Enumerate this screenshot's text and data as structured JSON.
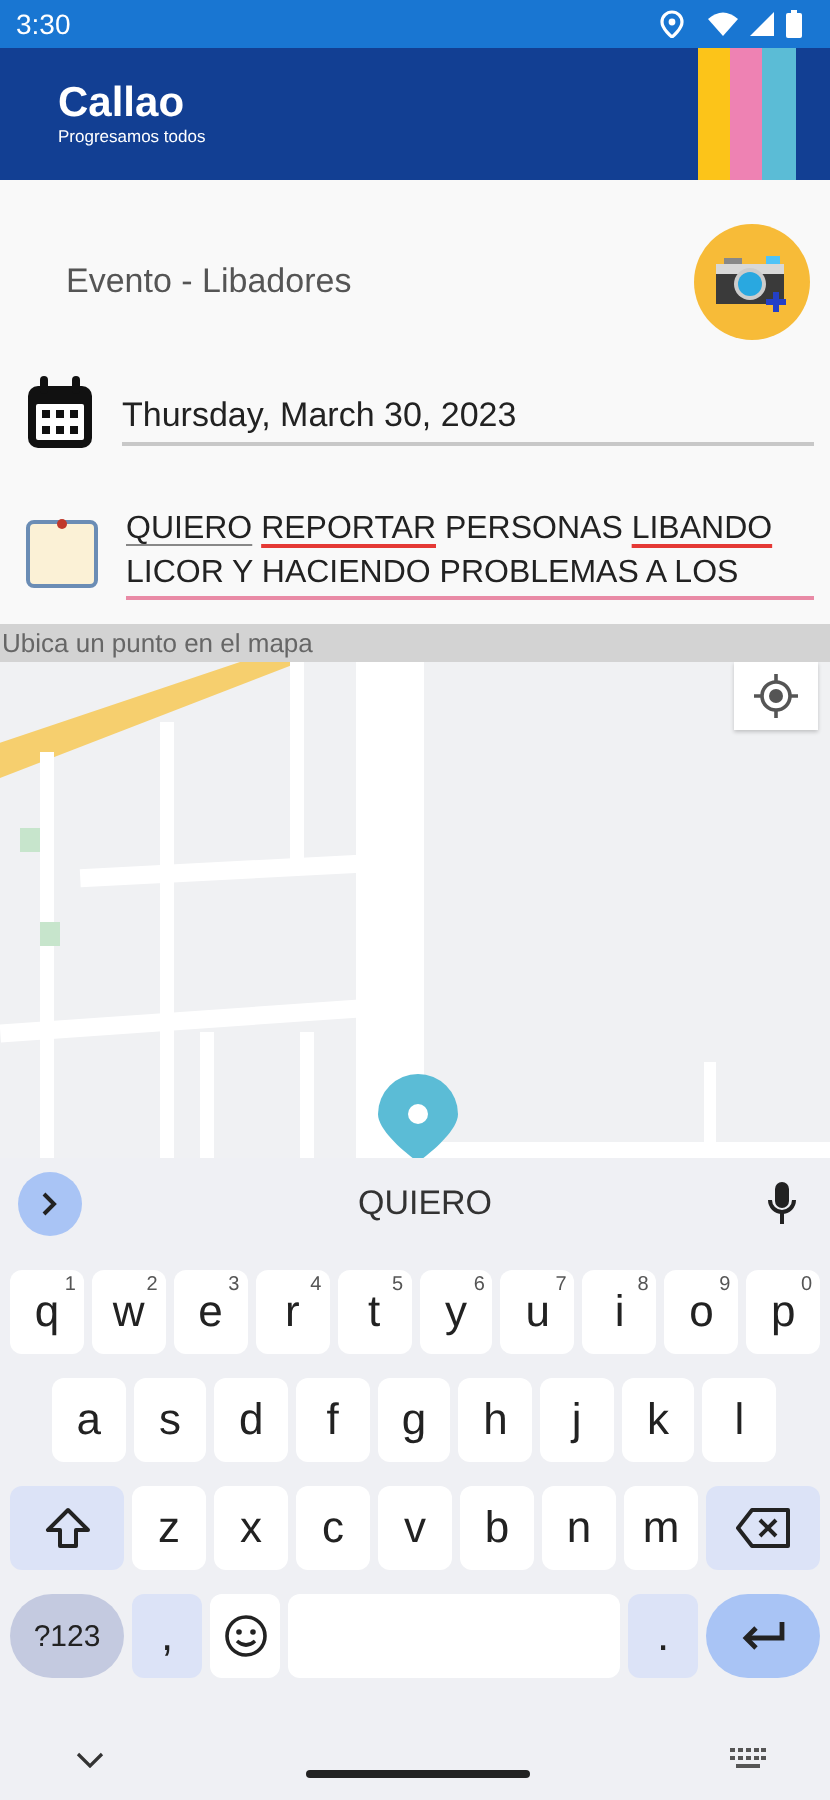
{
  "status_bar": {
    "time": "3:30"
  },
  "header": {
    "logo": "Callao",
    "tagline": "Progresamos todos"
  },
  "title": "Evento - Libadores",
  "date_field": {
    "value": "Thursday, March 30, 2023",
    "focused": false
  },
  "description_field": {
    "focused": true,
    "segments": [
      {
        "text": "QUIERO",
        "composing": true,
        "misspelled": false
      },
      {
        "text": "REPORTAR",
        "composing": false,
        "misspelled": true
      },
      {
        "text": "PERSONAS",
        "composing": false,
        "misspelled": false
      },
      {
        "text": "LIBANDO",
        "composing": false,
        "misspelled": true
      },
      {
        "text": "LICOR Y HACIENDO PROBLEMAS A LOS",
        "composing": false,
        "misspelled": false
      }
    ]
  },
  "map": {
    "label": "Ubica un punto en el mapa",
    "kind": "picture"
  },
  "keyboard": {
    "suggestion": "QUIERO",
    "rows": [
      {
        "keys": [
          {
            "kind": "letter",
            "label": "q",
            "hint": "1"
          },
          {
            "kind": "letter",
            "label": "w",
            "hint": "2"
          },
          {
            "kind": "letter",
            "label": "e",
            "hint": "3"
          },
          {
            "kind": "letter",
            "label": "r",
            "hint": "4"
          },
          {
            "kind": "letter",
            "label": "t",
            "hint": "5"
          },
          {
            "kind": "letter",
            "label": "y",
            "hint": "6"
          },
          {
            "kind": "letter",
            "label": "u",
            "hint": "7"
          },
          {
            "kind": "letter",
            "label": "i",
            "hint": "8"
          },
          {
            "kind": "letter",
            "label": "o",
            "hint": "9"
          },
          {
            "kind": "letter",
            "label": "p",
            "hint": "0"
          }
        ]
      },
      {
        "keys": [
          {
            "kind": "letter",
            "label": "a"
          },
          {
            "kind": "letter",
            "label": "s"
          },
          {
            "kind": "letter",
            "label": "d"
          },
          {
            "kind": "letter",
            "label": "f"
          },
          {
            "kind": "letter",
            "label": "g"
          },
          {
            "kind": "letter",
            "label": "h"
          },
          {
            "kind": "letter",
            "label": "j"
          },
          {
            "kind": "letter",
            "label": "k"
          },
          {
            "kind": "letter",
            "label": "l"
          }
        ]
      },
      {
        "keys": [
          {
            "kind": "shift"
          },
          {
            "kind": "letter",
            "label": "z"
          },
          {
            "kind": "letter",
            "label": "x"
          },
          {
            "kind": "letter",
            "label": "c"
          },
          {
            "kind": "letter",
            "label": "v"
          },
          {
            "kind": "letter",
            "label": "b"
          },
          {
            "kind": "letter",
            "label": "n"
          },
          {
            "kind": "letter",
            "label": "m"
          },
          {
            "kind": "backspace"
          }
        ]
      },
      {
        "keys": [
          {
            "kind": "symbols",
            "label": "?123"
          },
          {
            "kind": "punct",
            "label": ","
          },
          {
            "kind": "emoji"
          },
          {
            "kind": "space"
          },
          {
            "kind": "punct",
            "label": "."
          },
          {
            "kind": "enter"
          }
        ]
      }
    ]
  }
}
